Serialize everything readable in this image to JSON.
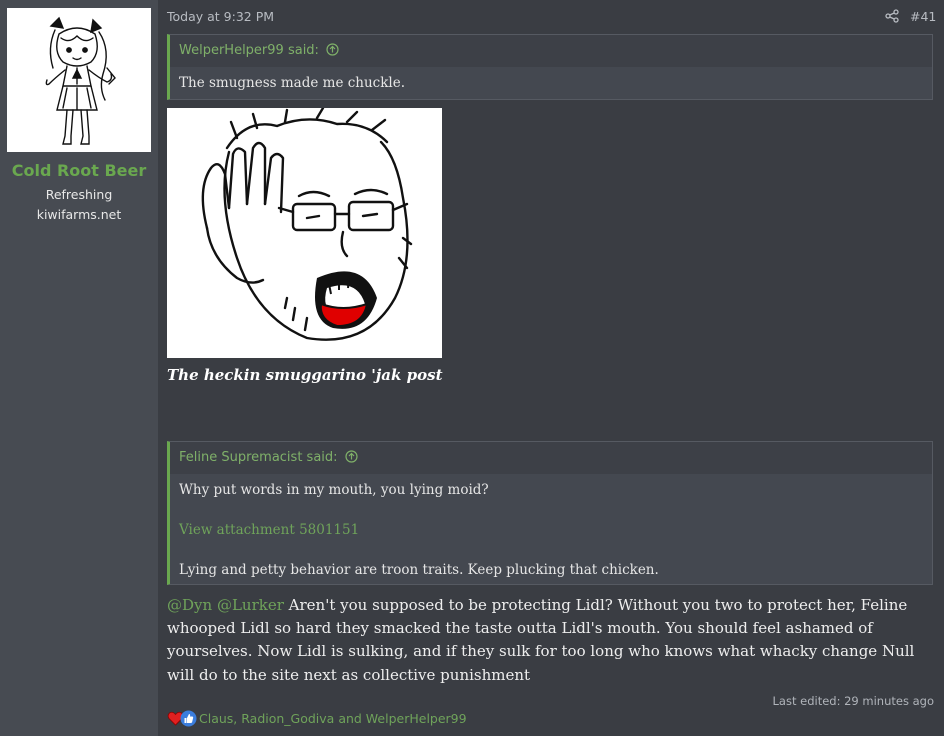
{
  "author": {
    "username": "Cold Root Beer",
    "title_line1": "Refreshing",
    "title_line2": "kiwifarms.net",
    "avatar_icon": "anime-girl-avatar"
  },
  "post": {
    "timestamp": "Today at 9:32 PM",
    "post_number": "#41",
    "quotes": [
      {
        "author": "WelperHelper99 said:",
        "lines": [
          "The smugness made me chuckle."
        ]
      },
      {
        "author": "Feline Supremacist said:",
        "line1": "Why put words in my mouth, you lying moid?",
        "attachment": "View attachment 5801151",
        "line2": "Lying and petty behavior are troon traits. Keep plucking that chicken."
      }
    ],
    "image_icon": "soyjak-meme-image",
    "caption": "The heckin smuggarino 'jak post",
    "mentions": [
      "@Dyn",
      "@Lurker"
    ],
    "body": "Aren't you supposed to be protecting Lidl? Without you two to protect her, Feline whooped Lidl so hard they smacked the taste outta Lidl's mouth. You should feel ashamed of yourselves. Now Lidl is sulking, and if they sulk for too long who knows what whacky change Null will do to the site next as collective punishment",
    "last_edited": "Last edited: 29 minutes ago",
    "reactions": {
      "icons": [
        "heart-icon",
        "thumbs-up-icon"
      ],
      "names": "Claus, Radion_Godiva and WelperHelper99"
    }
  },
  "colors": {
    "accent_green": "#6aa84f",
    "background": "#3a3d43",
    "sidebar": "#474b52"
  }
}
